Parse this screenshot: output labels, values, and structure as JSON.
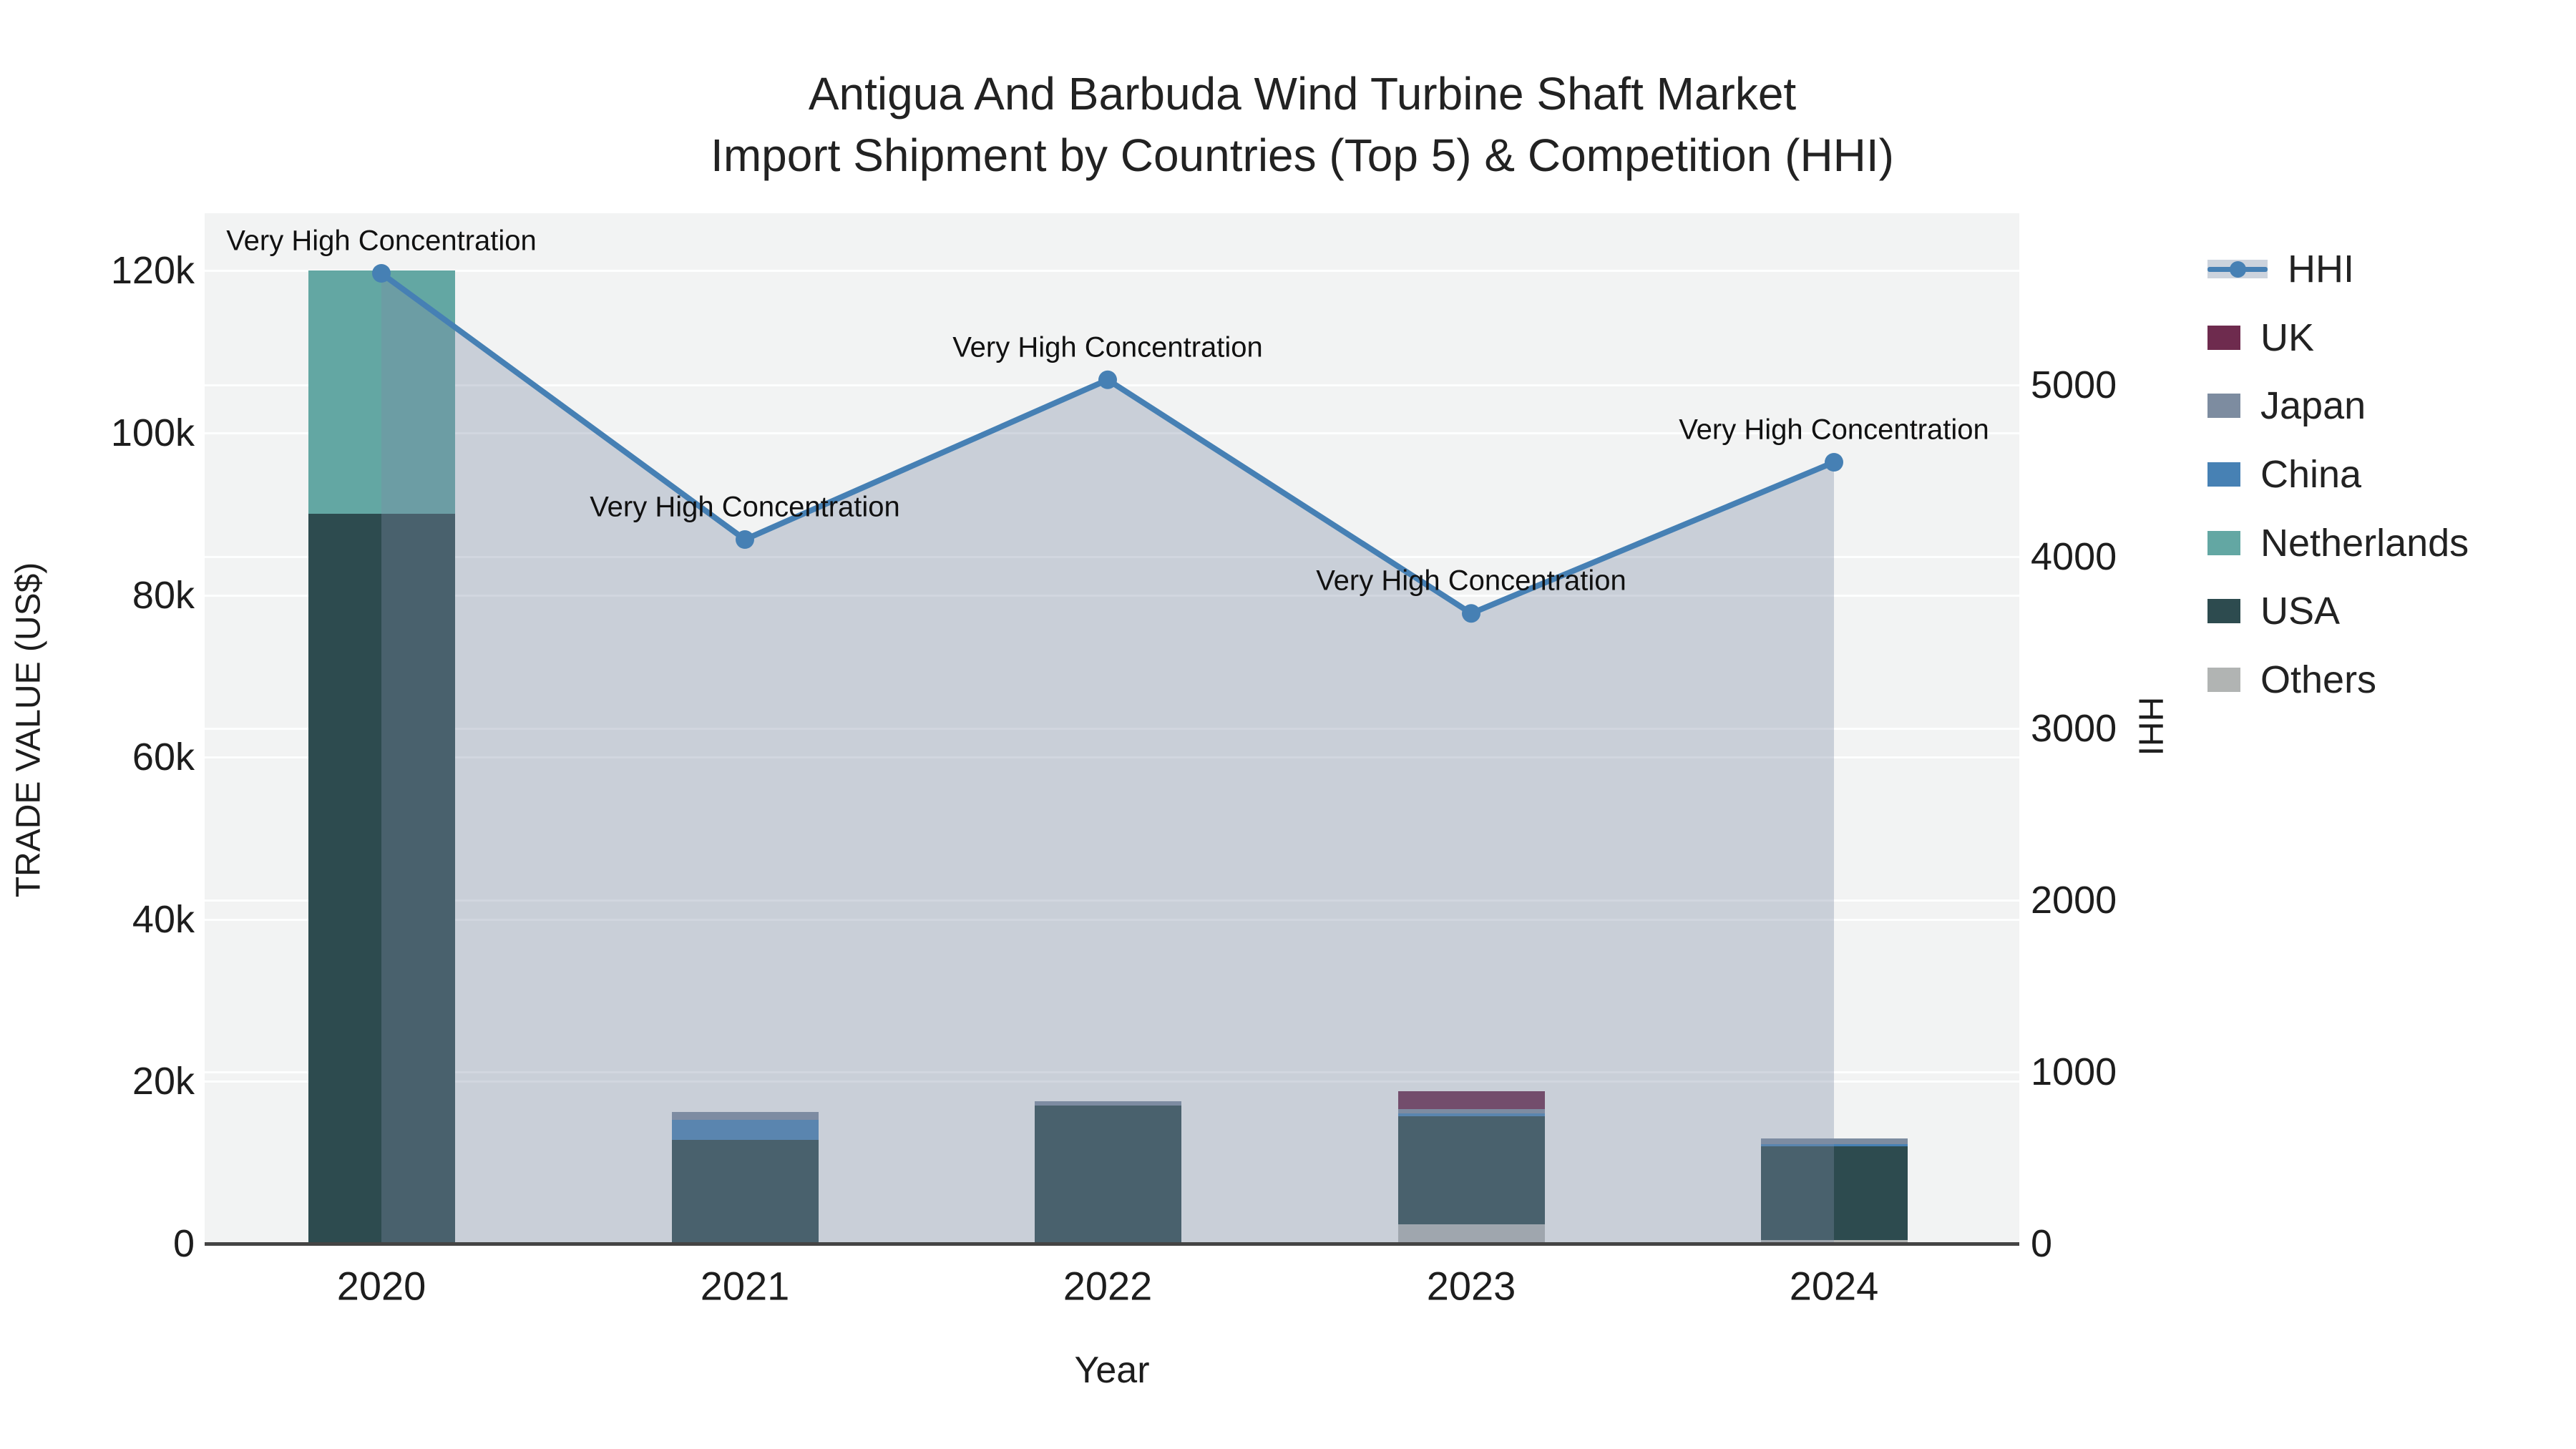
{
  "title": {
    "line1": "Antigua And Barbuda Wind Turbine Shaft Market",
    "line2": "Import Shipment by Countries (Top 5) & Competition (HHI)"
  },
  "axes": {
    "y_left": {
      "title": "TRADE VALUE (US$)",
      "tick_labels": [
        "0",
        "20k",
        "40k",
        "60k",
        "80k",
        "100k",
        "120k"
      ],
      "tick_values": [
        0,
        20000,
        40000,
        60000,
        80000,
        100000,
        120000
      ]
    },
    "y_right": {
      "title": "HHI",
      "tick_labels": [
        "0",
        "1000",
        "2000",
        "3000",
        "4000",
        "5000"
      ],
      "tick_values": [
        0,
        1000,
        2000,
        3000,
        4000,
        5000
      ]
    },
    "x": {
      "title": "Year",
      "tick_labels": [
        "2020",
        "2021",
        "2022",
        "2023",
        "2024"
      ]
    }
  },
  "legend": [
    {
      "label": "HHI",
      "kind": "line",
      "color": "#4680b4"
    },
    {
      "label": "UK",
      "kind": "swatch",
      "color": "#6e2b4e"
    },
    {
      "label": "Japan",
      "kind": "swatch",
      "color": "#7d8ca0"
    },
    {
      "label": "China",
      "kind": "swatch",
      "color": "#4781b4"
    },
    {
      "label": "Netherlands",
      "kind": "swatch",
      "color": "#63a7a3"
    },
    {
      "label": "USA",
      "kind": "swatch",
      "color": "#2d4b4f"
    },
    {
      "label": "Others",
      "kind": "swatch",
      "color": "#b1b4b3"
    }
  ],
  "colors": {
    "plot_background": "#f2f3f3",
    "gridline": "#ffffff",
    "axis_line": "#444444",
    "hhi_line": "#4680b4",
    "hhi_area_fill": "rgba(125,140,165,0.35)"
  },
  "chart_data": {
    "type": "bar",
    "subtype": "stacked-bars-with-dual-axis-line",
    "title": "Antigua And Barbuda Wind Turbine Shaft Market — Import Shipment by Countries (Top 5) & Competition (HHI)",
    "categories": [
      "2020",
      "2021",
      "2022",
      "2023",
      "2024"
    ],
    "xlabel": "Year",
    "ylabel_left": "TRADE VALUE (US$)",
    "ylabel_right": "HHI",
    "ylim_left": [
      0,
      127000
    ],
    "ylim_right": [
      0,
      6000
    ],
    "grid": true,
    "legend_position": "right",
    "stack_order": "bottom-to-top",
    "series": [
      {
        "name": "Others",
        "axis": "y1",
        "color": "#b1b4b3",
        "values": [
          0,
          0,
          0,
          2400,
          400
        ]
      },
      {
        "name": "USA",
        "axis": "y1",
        "color": "#2d4b4f",
        "values": [
          90000,
          12800,
          17000,
          13300,
          11600
        ]
      },
      {
        "name": "Netherlands",
        "axis": "y1",
        "color": "#63a7a3",
        "values": [
          30000,
          0,
          0,
          0,
          0
        ]
      },
      {
        "name": "China",
        "axis": "y1",
        "color": "#4781b4",
        "values": [
          0,
          2500,
          0,
          350,
          250
        ]
      },
      {
        "name": "Japan",
        "axis": "y1",
        "color": "#7d8ca0",
        "values": [
          0,
          900,
          600,
          550,
          750
        ]
      },
      {
        "name": "UK",
        "axis": "y1",
        "color": "#6e2b4e",
        "values": [
          0,
          0,
          0,
          2200,
          0
        ]
      }
    ],
    "line_series": {
      "name": "HHI",
      "axis": "y2",
      "color": "#4680b4",
      "values": [
        5650,
        4100,
        5030,
        3670,
        4550
      ],
      "area_fill": true,
      "annotations": [
        "Very High Concentration",
        "Very High Concentration",
        "Very High Concentration",
        "Very High Concentration",
        "Very High Concentration"
      ]
    }
  }
}
